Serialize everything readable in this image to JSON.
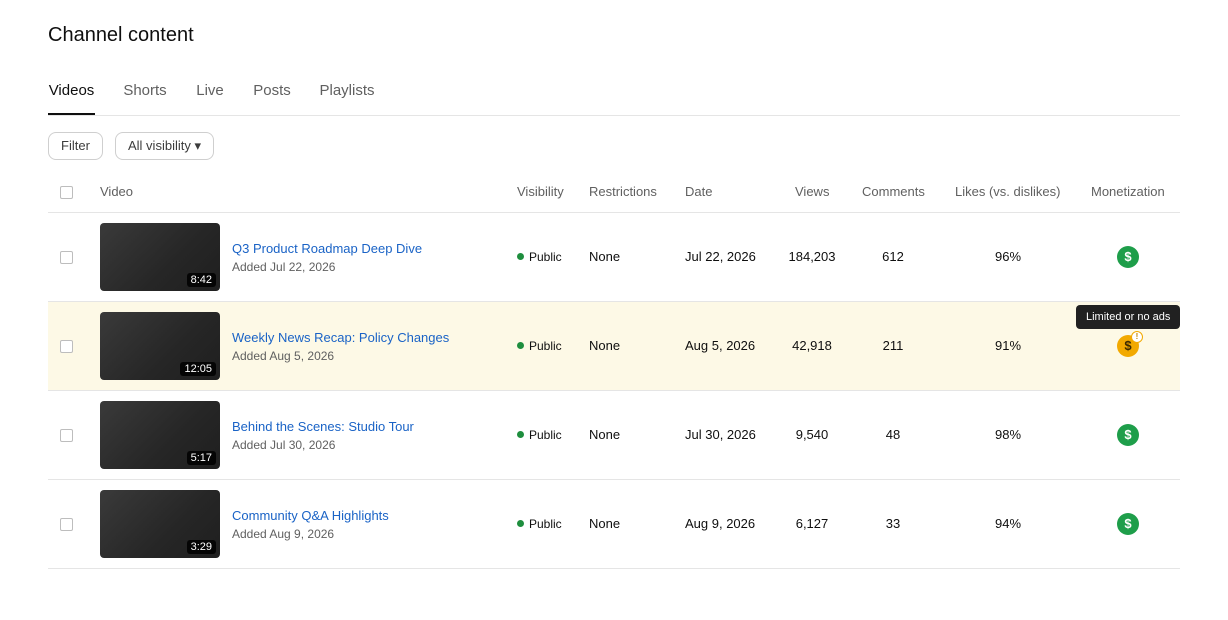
{
  "page_title": "Channel content",
  "tabs": [
    {
      "label": "Videos",
      "active": true
    },
    {
      "label": "Shorts",
      "active": false
    },
    {
      "label": "Live",
      "active": false
    },
    {
      "label": "Posts",
      "active": false
    },
    {
      "label": "Playlists",
      "active": false
    }
  ],
  "toolbar": {
    "filter_label": "Filter",
    "visibility_label": "All visibility ▾"
  },
  "columns": {
    "video": "Video",
    "visibility": "Visibility",
    "restrictions": "Restrictions",
    "date": "Date",
    "views": "Views",
    "comments": "Comments",
    "likes": "Likes (vs. dislikes)",
    "monetization": "Monetization"
  },
  "rows": [
    {
      "title": "Q3 Product Roadmap Deep Dive",
      "added": "Added Jul 22, 2026",
      "duration": "8:42",
      "visibility": "Public",
      "restrictions": "None",
      "date": "Jul 22, 2026",
      "views": "184,203",
      "comments": "612",
      "likes": "96%",
      "monetization_symbol": "$",
      "monetization_status": "on",
      "highlighted": false
    },
    {
      "title": "Weekly News Recap: Policy Changes",
      "added": "Added Aug 5, 2026",
      "duration": "12:05",
      "visibility": "Public",
      "restrictions": "None",
      "date": "Aug 5, 2026",
      "views": "42,918",
      "comments": "211",
      "likes": "91%",
      "monetization_symbol": "$",
      "monetization_status": "limited",
      "highlighted": true
    },
    {
      "title": "Behind the Scenes: Studio Tour",
      "added": "Added Jul 30, 2026",
      "duration": "5:17",
      "visibility": "Public",
      "restrictions": "None",
      "date": "Jul 30, 2026",
      "views": "9,540",
      "comments": "48",
      "likes": "98%",
      "monetization_symbol": "$",
      "monetization_status": "on",
      "highlighted": false
    },
    {
      "title": "Community Q&A Highlights",
      "added": "Added Aug 9, 2026",
      "duration": "3:29",
      "visibility": "Public",
      "restrictions": "None",
      "date": "Aug 9, 2026",
      "views": "6,127",
      "comments": "33",
      "likes": "94%",
      "monetization_symbol": "$",
      "monetization_status": "on",
      "highlighted": false
    }
  ],
  "tooltip": {
    "text": "Limited or no ads",
    "warning_symbol": "!"
  },
  "colors": {
    "link": "#1a63c6",
    "public_dot": "#1e8e3e",
    "monetized": "#1e9e4a",
    "limited": "#f2a900",
    "highlight_row": "#fdf9e6"
  }
}
